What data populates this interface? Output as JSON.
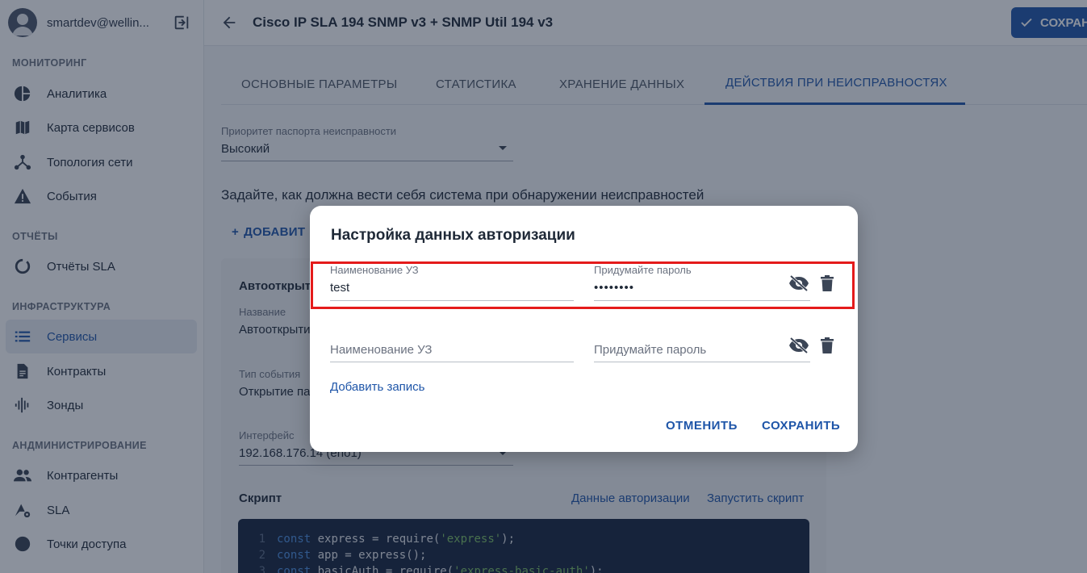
{
  "sidebar": {
    "user": "smartdev@wellin...",
    "sections": {
      "monitoring": "МОНИТОРИНГ",
      "reports": "ОТЧЁТЫ",
      "infrastructure": "ИНФРАСТРУКТУРА",
      "admin": "АНДМИНИСТРИРОВАНИЕ"
    },
    "items": [
      {
        "label": "Аналитика",
        "icon": "pie-chart-icon"
      },
      {
        "label": "Карта сервисов",
        "icon": "map-icon"
      },
      {
        "label": "Топология сети",
        "icon": "topology-icon"
      },
      {
        "label": "События",
        "icon": "warning-icon"
      },
      {
        "label": "Отчёты SLA",
        "icon": "report-circle-icon"
      },
      {
        "label": "Сервисы",
        "icon": "list-icon",
        "active": true
      },
      {
        "label": "Контракты",
        "icon": "document-icon"
      },
      {
        "label": "Зонды",
        "icon": "waveform-icon"
      },
      {
        "label": "Контрагенты",
        "icon": "people-icon"
      },
      {
        "label": "SLA",
        "icon": "sla-gear-icon"
      },
      {
        "label": "Точки доступа",
        "icon": "circle-icon"
      }
    ]
  },
  "header": {
    "title": "Cisco IP SLA 194 SNMP v3 + SNMP Util 194 v3",
    "save_label": "СОХРАН"
  },
  "tabs": [
    {
      "label": "ОСНОВНЫЕ ПАРАМЕТРЫ"
    },
    {
      "label": "СТАТИСТИКА"
    },
    {
      "label": "ХРАНЕНИЕ ДАННЫХ"
    },
    {
      "label": "ДЕЙСТВИЯ ПРИ НЕИСПРАВНОСТЯХ",
      "active": true
    }
  ],
  "main": {
    "priority_label": "Приоритет паспорта неисправности",
    "priority_value": "Высокий",
    "description": "Задайте, как должна вести себя система при обнаружении неисправностей",
    "add_label": "ДОБАВИТ",
    "card": {
      "title": "Автооткрыт",
      "name_label": "Название",
      "name_value": "Автооткрыти",
      "event_type_label": "Тип события",
      "event_type_value": "Открытие па",
      "interface_label": "Интерфейс",
      "interface_value": "192.168.176.14 (eno1)",
      "script_label": "Скрипт",
      "auth_link": "Данные авторизации",
      "run_link": "Запустить скрипт",
      "code": [
        {
          "num": "1",
          "kw": "const",
          "text": " express = require(",
          "str": "'express'",
          "end": ");"
        },
        {
          "num": "2",
          "kw": "const",
          "text": " app = express();",
          "str": "",
          "end": ""
        },
        {
          "num": "3",
          "kw": "const",
          "text": " basicAuth = require(",
          "str": "'express-basic-auth'",
          "end": ");"
        }
      ]
    }
  },
  "dialog": {
    "title": "Настройка данных авторизации",
    "rows": [
      {
        "account_label": "Наименование УЗ",
        "account_value": "test",
        "password_label": "Придумайте пароль",
        "password_value": "••••••••"
      },
      {
        "account_placeholder": "Наименование УЗ",
        "password_placeholder": "Придумайте пароль"
      }
    ],
    "add_record": "Добавить запись",
    "cancel": "ОТМЕНИТЬ",
    "save": "СОХРАНИТЬ",
    "highlight_color": "#e41b1b"
  }
}
